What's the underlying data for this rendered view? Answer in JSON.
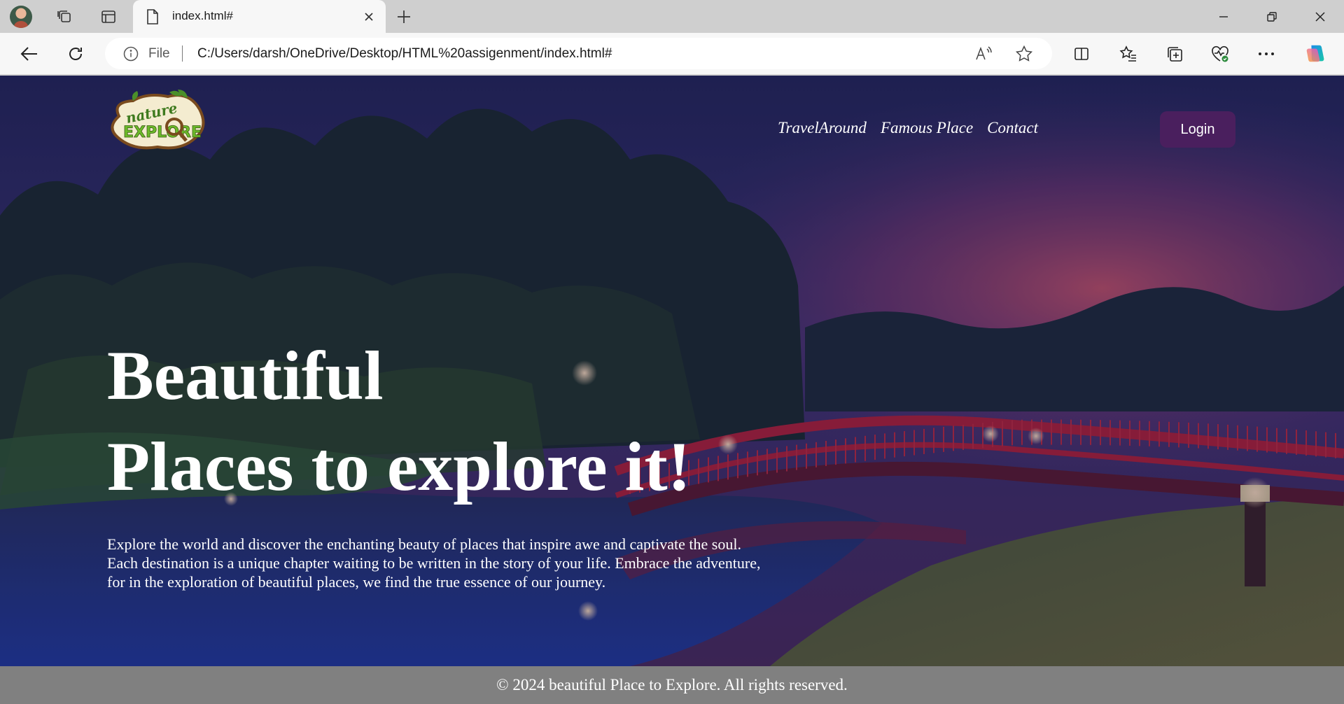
{
  "browser": {
    "tab_title": "index.html#",
    "address_prefix": "File",
    "url": "C:/Users/darsh/OneDrive/Desktop/HTML%20assigenment/index.html#",
    "icons": [
      "profile-avatar",
      "workspaces-icon",
      "tab-actions-icon",
      "page-icon",
      "close-icon",
      "plus-icon",
      "minimize-icon",
      "restore-icon",
      "close-window-icon",
      "back-arrow-icon",
      "refresh-icon",
      "info-icon",
      "read-aloud-icon",
      "favorite-star-icon",
      "split-screen-icon",
      "favorites-list-icon",
      "collections-icon",
      "browser-essentials-icon",
      "more-options-icon",
      "copilot-icon"
    ]
  },
  "site": {
    "logo_text_top": "nature",
    "logo_text_bottom": "EXPLORE",
    "nav": [
      {
        "label": "TravelAround"
      },
      {
        "label": "Famous Place"
      },
      {
        "label": "Contact"
      }
    ],
    "login_label": "Login",
    "headline_line1": "Beautiful",
    "headline_line2": "Places to explore it!",
    "description": "Explore the world and discover the enchanting beauty of places that inspire awe and captivate the soul. Each destination is a unique chapter waiting to be written in the story of your life. Embrace the adventure, for in the exploration of beautiful places, we find the true essence of our journey.",
    "footer": "© 2024 beautiful Place to Explore. All rights reserved."
  },
  "colors": {
    "login_bg": "#4a1f5e",
    "footer_bg": "#808080",
    "bridge": "#b2213a",
    "chrome_bg": "#cfcfcf"
  }
}
